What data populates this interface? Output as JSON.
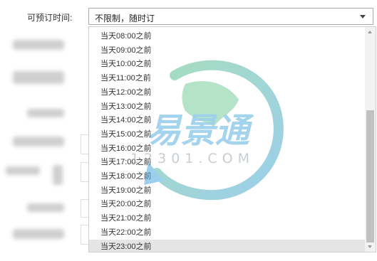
{
  "form": {
    "label": "可预订时间:",
    "select": {
      "value": "不限制，随时订",
      "options": [
        "当天08:00之前",
        "当天09:00之前",
        "当天10:00之前",
        "当天11:00之前",
        "当天12:00之前",
        "当天13:00之前",
        "当天14:00之前",
        "当天15:00之前",
        "当天16:00之前",
        "当天17:00之前",
        "当天18:00之前",
        "当天19:00之前",
        "当天20:00之前",
        "当天21:00之前",
        "当天22:00之前",
        "当天23:00之前"
      ],
      "highlighted_option": "当天23:00之前"
    }
  },
  "watermark": {
    "brand": "易景通",
    "domain": "12301.COM"
  },
  "colors": {
    "watermark_green": "#5fc28a",
    "watermark_blue": "#4aa8dc",
    "highlight": "#e5e5e5"
  }
}
